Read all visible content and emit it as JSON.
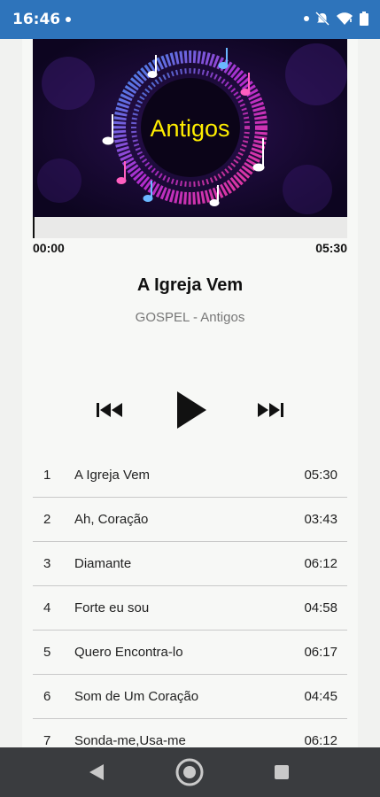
{
  "status_bar": {
    "time": "16:46"
  },
  "album": {
    "cover_text": "Antigos"
  },
  "player": {
    "elapsed": "00:00",
    "total": "05:30",
    "progress": 0,
    "title": "A Igreja Vem",
    "subtitle": "GOSPEL - Antigos"
  },
  "tracks": [
    {
      "num": "1",
      "name": "A Igreja Vem",
      "duration": "05:30"
    },
    {
      "num": "2",
      "name": "Ah, Coração",
      "duration": "03:43"
    },
    {
      "num": "3",
      "name": "Diamante",
      "duration": "06:12"
    },
    {
      "num": "4",
      "name": "Forte eu sou",
      "duration": "04:58"
    },
    {
      "num": "5",
      "name": "Quero Encontra-lo",
      "duration": "06:17"
    },
    {
      "num": "6",
      "name": "Som de Um Coração",
      "duration": "04:45"
    },
    {
      "num": "7",
      "name": "Sonda-me,Usa-me",
      "duration": "06:12"
    }
  ],
  "colors": {
    "status_bar": "#2e74bb",
    "nav_bar": "#3a3c3f",
    "cover_text": "#ffee00"
  }
}
